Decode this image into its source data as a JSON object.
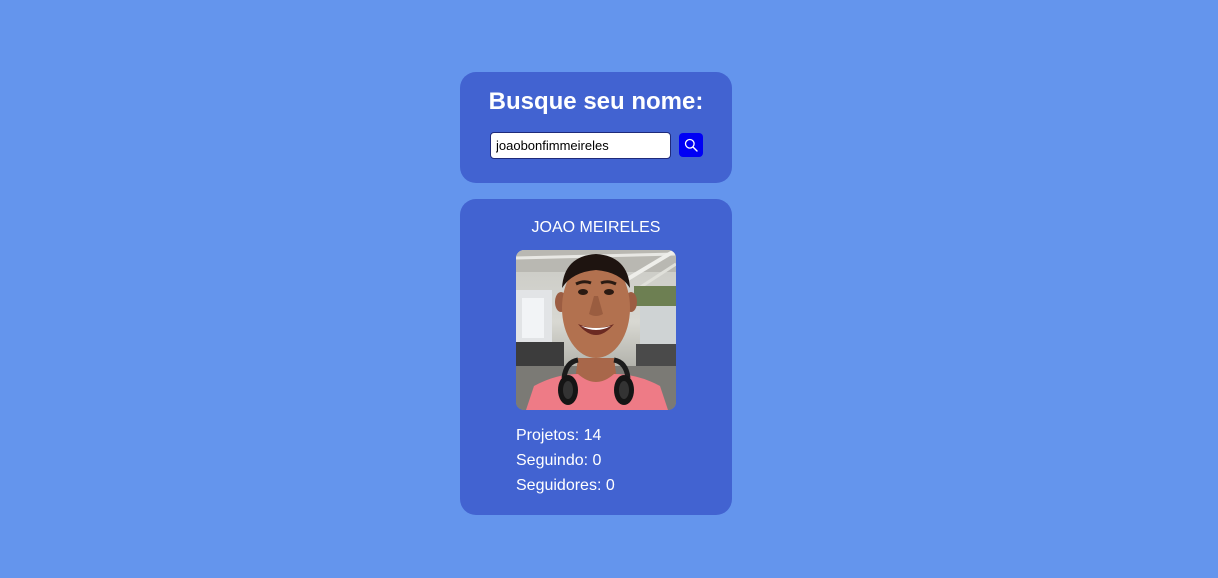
{
  "search": {
    "title": "Busque seu nome:",
    "input_value": "joaobonfimmeireles",
    "button_icon": "search-icon"
  },
  "profile": {
    "name": "JOAO MEIRELES",
    "avatar_icon": "profile-photo",
    "stats": [
      {
        "label": "Projetos:",
        "value": "14"
      },
      {
        "label": "Seguindo:",
        "value": "0"
      },
      {
        "label": "Seguidores:",
        "value": "0"
      }
    ]
  },
  "colors": {
    "background": "#6495ED",
    "card": "#4263D1",
    "button": "#0000F5",
    "text": "#FFFFFF"
  }
}
